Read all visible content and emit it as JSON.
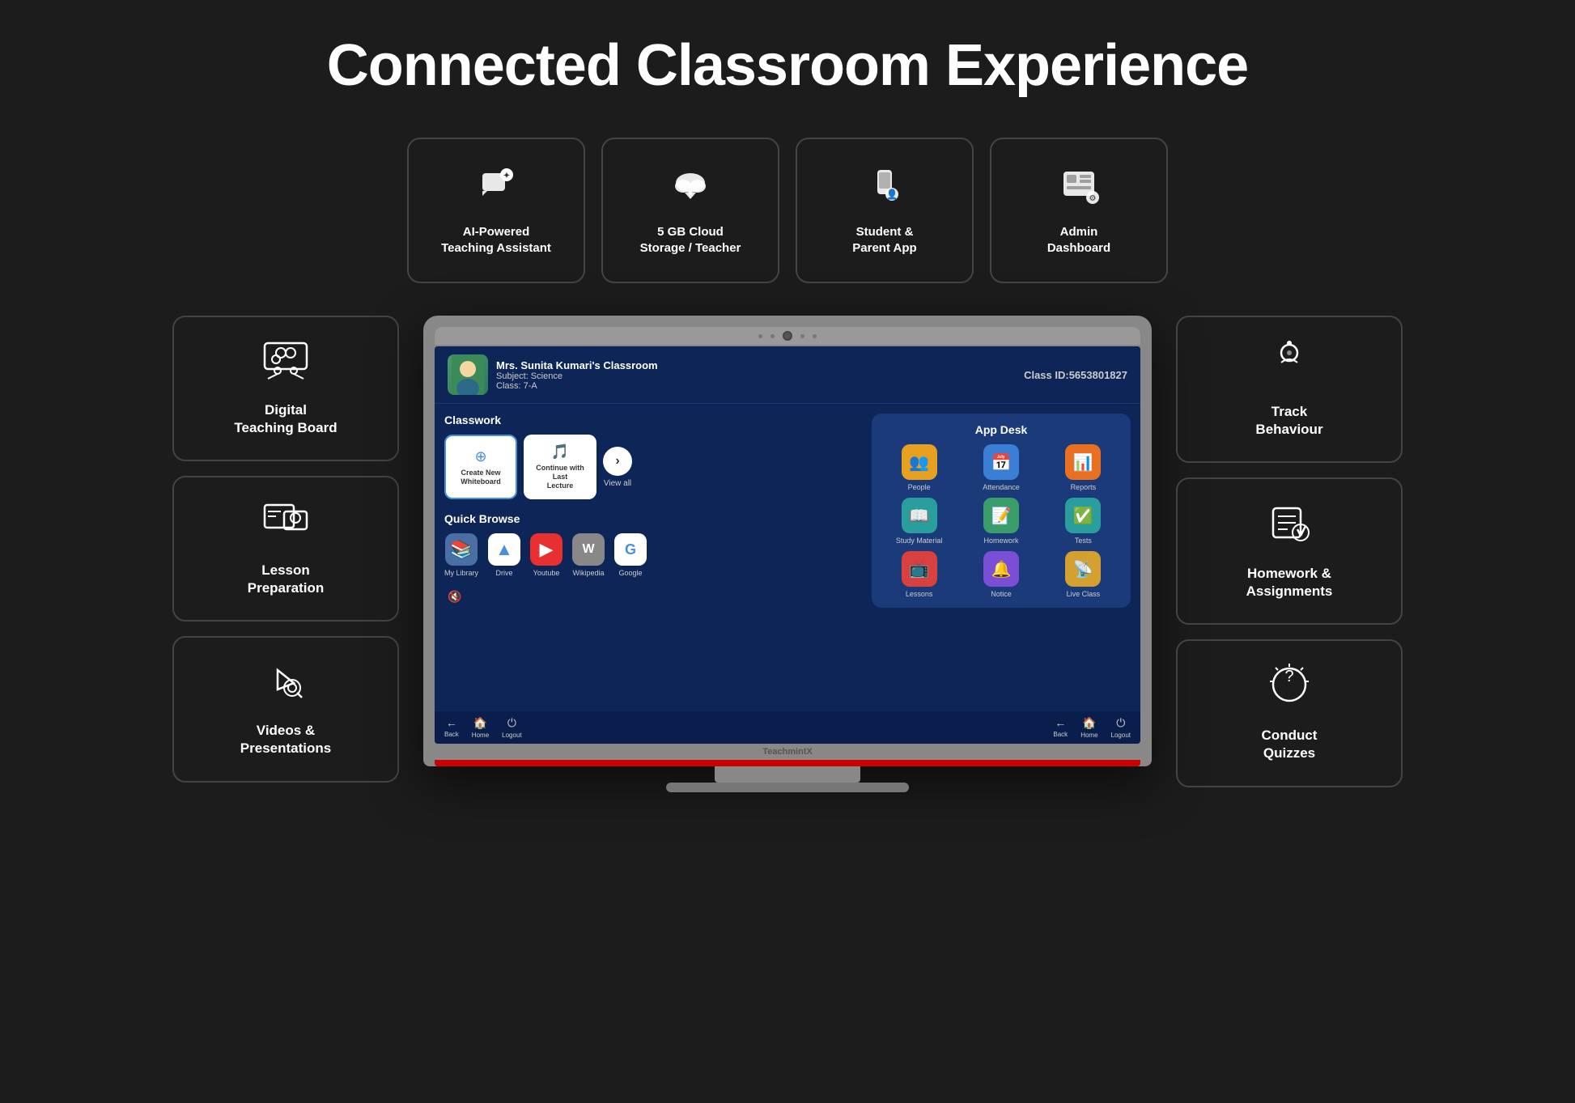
{
  "page": {
    "title": "Connected Classroom Experience"
  },
  "top_cards": [
    {
      "id": "ai-teaching",
      "icon": "🎓",
      "label": "AI-Powered\nTeaching Assistant"
    },
    {
      "id": "cloud-storage",
      "icon": "☁️",
      "label": "5 GB Cloud\nStorage / Teacher"
    },
    {
      "id": "student-parent",
      "icon": "📱",
      "label": "Student &\nParent App"
    },
    {
      "id": "admin-dashboard",
      "icon": "📊",
      "label": "Admin\nDashboard"
    }
  ],
  "sidebar_left": [
    {
      "id": "digital-teaching",
      "icon": "🖥️",
      "label": "Digital\nTeaching Board"
    },
    {
      "id": "lesson-prep",
      "icon": "📋",
      "label": "Lesson\nPreparation"
    },
    {
      "id": "videos-presentations",
      "icon": "🎬",
      "label": "Videos &\nPresentations"
    }
  ],
  "sidebar_right": [
    {
      "id": "track-behaviour",
      "icon": "🎤",
      "label": "Track\nBehaviour"
    },
    {
      "id": "homework-assignments",
      "icon": "📚",
      "label": "Homework &\nAssignments"
    },
    {
      "id": "conduct-quizzes",
      "icon": "💡",
      "label": "Conduct\nQuizzes"
    }
  ],
  "screen": {
    "teacher_name": "Mrs. Sunita Kumari's Classroom",
    "subject": "Subject: Science",
    "class": "Class: 7-A",
    "class_id": "Class ID:5653801827",
    "classwork_title": "Classwork",
    "classwork_items": [
      {
        "id": "create-whiteboard",
        "icon": "⭕",
        "label": "Create New\nWhiteboard"
      },
      {
        "id": "continue-lecture",
        "icon": "🎵",
        "label": "Continue with Last\nLecture"
      }
    ],
    "view_all_label": "View all",
    "quick_browse_title": "Quick Browse",
    "browse_items": [
      {
        "id": "my-library",
        "icon": "📚",
        "label": "My Library",
        "bg": "#4a6fa5"
      },
      {
        "id": "drive",
        "icon": "▲",
        "label": "Drive",
        "bg": "#4a90d9"
      },
      {
        "id": "youtube",
        "icon": "▶",
        "label": "Youtube",
        "bg": "#e83030"
      },
      {
        "id": "wikipedia",
        "icon": "W",
        "label": "Wikipedia",
        "bg": "#888"
      },
      {
        "id": "google",
        "icon": "G",
        "label": "Google",
        "bg": "#4a90d9"
      }
    ],
    "app_desk_title": "App Desk",
    "app_items": [
      {
        "id": "people",
        "icon": "👥",
        "label": "People",
        "bg": "#e8a020"
      },
      {
        "id": "attendance",
        "icon": "📅",
        "label": "Attendance",
        "bg": "#3a7fd5"
      },
      {
        "id": "reports",
        "icon": "📊",
        "label": "Reports",
        "bg": "#e87020"
      },
      {
        "id": "study-material",
        "icon": "📖",
        "label": "Study Material",
        "bg": "#3a9d6a"
      },
      {
        "id": "homework",
        "icon": "📝",
        "label": "Homework",
        "bg": "#3a9d3a"
      },
      {
        "id": "tests",
        "icon": "✅",
        "label": "Tests",
        "bg": "#3a9d9d"
      },
      {
        "id": "lessons",
        "icon": "📺",
        "label": "Lessons",
        "bg": "#d94040"
      },
      {
        "id": "notice",
        "icon": "🔔",
        "label": "Notice",
        "bg": "#7a4fd5"
      },
      {
        "id": "live-class",
        "icon": "📡",
        "label": "Live Class",
        "bg": "#d4a030"
      }
    ],
    "nav_left": [
      {
        "id": "back",
        "icon": "←",
        "label": "Back"
      },
      {
        "id": "home",
        "icon": "🏠",
        "label": "Home"
      },
      {
        "id": "logout",
        "icon": "⏻",
        "label": "Logout"
      }
    ],
    "nav_right": [
      {
        "id": "back-r",
        "icon": "←",
        "label": "Back"
      },
      {
        "id": "home-r",
        "icon": "🏠",
        "label": "Home"
      },
      {
        "id": "logout-r",
        "icon": "⏻",
        "label": "Logout"
      }
    ],
    "brand": "TeachmintX"
  }
}
